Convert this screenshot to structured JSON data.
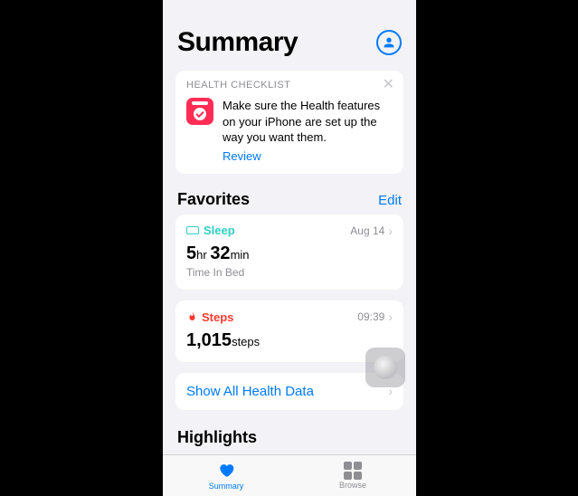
{
  "header": {
    "title": "Summary"
  },
  "checklist": {
    "eyebrow": "HEALTH CHECKLIST",
    "text": "Make sure the Health features on your iPhone are set up the way you want them.",
    "review": "Review"
  },
  "favorites": {
    "title": "Favorites",
    "edit": "Edit",
    "sleep": {
      "label": "Sleep",
      "date": "Aug 14",
      "hours": "5",
      "hours_unit": "hr",
      "mins": "32",
      "mins_unit": "min",
      "sub": "Time In Bed"
    },
    "steps": {
      "label": "Steps",
      "time": "09:39",
      "value": "1,015",
      "unit": "steps"
    },
    "show_all": "Show All Health Data"
  },
  "highlights": {
    "title": "Highlights"
  },
  "tabs": {
    "summary": "Summary",
    "browse": "Browse"
  }
}
